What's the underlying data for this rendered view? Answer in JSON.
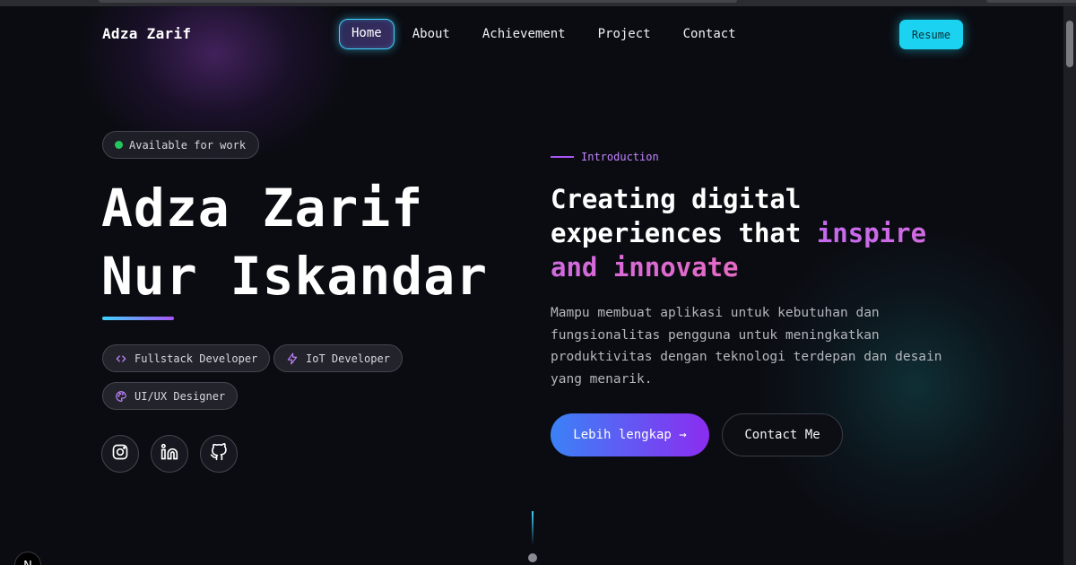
{
  "nav": {
    "brand": "Adza Zarif",
    "links": [
      {
        "label": "Home",
        "active": true
      },
      {
        "label": "About",
        "active": false
      },
      {
        "label": "Achievement",
        "active": false
      },
      {
        "label": "Project",
        "active": false
      },
      {
        "label": "Contact",
        "active": false
      }
    ],
    "resume_label": "Resume"
  },
  "hero": {
    "availability": "Available for work",
    "name_line1": "Adza Zarif",
    "name_line2": "Nur Iskandar",
    "roles": [
      {
        "label": "Fullstack Developer",
        "icon": "code-icon"
      },
      {
        "label": "IoT Developer",
        "icon": "bolt-icon"
      },
      {
        "label": "UI/UX Designer",
        "icon": "palette-icon"
      }
    ],
    "socials": [
      "instagram-icon",
      "linkedin-icon",
      "github-icon"
    ]
  },
  "intro": {
    "label": "Introduction",
    "headline_part1": "Creating digital experiences that ",
    "headline_highlight": "inspire and innovate",
    "description": "Mampu membuat aplikasi untuk kebutuhan dan fungsionalitas pengguna untuk meningkatkan produktivitas dengan teknologi terdepan dan desain yang menarik.",
    "primary_button": "Lebih lengkap →",
    "secondary_button": "Contact Me"
  },
  "framework_badge": "N",
  "colors": {
    "background": "#0b0c12",
    "accent_cyan": "#1bd3f0",
    "accent_purple": "#a855f7",
    "available_green": "#22c55e"
  }
}
